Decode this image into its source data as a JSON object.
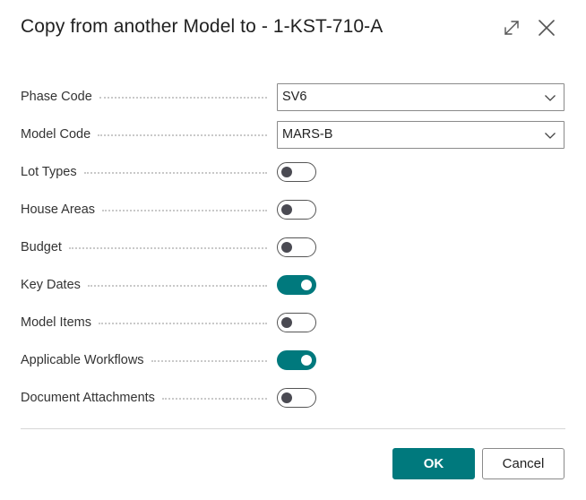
{
  "dialog": {
    "title": "Copy from another Model to - 1-KST-710-A",
    "header_icons": [
      "expand-icon",
      "close-icon"
    ]
  },
  "fields": {
    "phase_code": {
      "label": "Phase Code",
      "value": "SV6"
    },
    "model_code": {
      "label": "Model Code",
      "value": "MARS-B"
    }
  },
  "toggles": [
    {
      "label": "Lot Types",
      "on": false
    },
    {
      "label": "House Areas",
      "on": false
    },
    {
      "label": "Budget",
      "on": false
    },
    {
      "label": "Key Dates",
      "on": true
    },
    {
      "label": "Model Items",
      "on": false
    },
    {
      "label": "Applicable Workflows",
      "on": true
    },
    {
      "label": "Document Attachments",
      "on": false
    }
  ],
  "buttons": {
    "ok": "OK",
    "cancel": "Cancel"
  },
  "colors": {
    "accent": "#00797d",
    "toggle_off_border": "#555555"
  }
}
